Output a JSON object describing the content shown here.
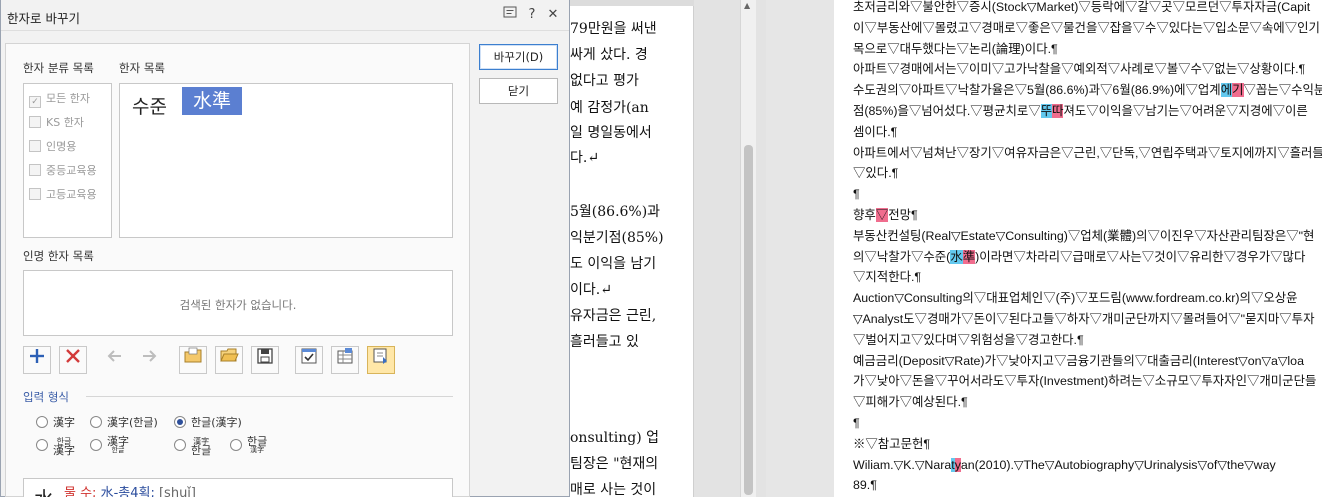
{
  "dialog": {
    "title": "한자로 바꾸기",
    "titlebar_icons": [
      "window-icon",
      "help-icon",
      "close-icon"
    ],
    "help_label": "?",
    "close_label": "✕",
    "category_label": "한자 분류 목록",
    "hanja_list_label": "한자 목록",
    "categories": [
      {
        "label": "모든 한자",
        "checked": true
      },
      {
        "label": "KS 한자",
        "checked": false
      },
      {
        "label": "인명용",
        "checked": false
      },
      {
        "label": "중등교육용",
        "checked": false
      },
      {
        "label": "고등교육용",
        "checked": false
      }
    ],
    "reading": "수준",
    "hanja_selected": "水準",
    "person_label": "인명 한자 목록",
    "person_empty": "검색된 한자가 없습니다.",
    "format_label": "입력 형식",
    "formats_row1": [
      "漢字",
      "漢字(한글)",
      "한글(漢字)"
    ],
    "format_stack": [
      {
        "top": "한글",
        "bottom": "漢字"
      },
      {
        "top": "漢字",
        "bottom": "한글"
      },
      {
        "top": "漢字",
        "bottom": "한글"
      },
      {
        "top": "한글",
        "bottom": "漢字"
      }
    ],
    "selected_format": "한글(漢字)",
    "info_char": "水",
    "info_meaning": "물 수;",
    "info_radical": "水-총4획;",
    "info_pinyin": "[shuǐ]",
    "replace_button": "바꾸기(D)",
    "close_button": "닫기"
  },
  "doc_left_lines": [
    "79만원을 써낸",
    "싸게 샀다. 경",
    "없다고 평가",
    "예 감정가(an",
    "일 명일동에서",
    "다.↵",
    "5월(86.6%)과",
    "익분기점(85%)",
    "도 이익을 남기",
    "이다.↵",
    "유자금은 근린,",
    "흘러들고 있",
    "onsulting) 업",
    "팀장은 \"현재의",
    "매로 사는 것이"
  ],
  "doc_right_lines": [
    [
      {
        "t": "초저금리와▽불안한▽증시(Stock▽Market)▽등락에▽갈▽곳▽모르던▽투자자금(Capit"
      }
    ],
    [
      {
        "t": "이▽부동산에▽몰렸고▽경매로▽좋은▽물건을▽잡을▽수▽있다는▽입소문▽속에▽인기"
      }
    ],
    [
      {
        "t": "목으로▽대두했다는▽논리(論理)이다.¶"
      }
    ],
    [
      {
        "t": "아파트▽경매에서는▽이미▽고가낙찰을▽예외적▽사례로▽볼▽수▽없는▽상황이다.¶"
      }
    ],
    [
      {
        "t": "수도권의▽아파트▽낙찰가율은▽5월(86.6%)과▽6월(86.9%)에▽업계"
      },
      {
        "t": "에",
        "c": "b"
      },
      {
        "t": "기",
        "c": "p"
      },
      {
        "t": "▽꼽는▽수익분"
      }
    ],
    [
      {
        "t": "점(85%)을▽넘어섰다.▽평균치로▽"
      },
      {
        "t": "뚜",
        "c": "b"
      },
      {
        "t": "따",
        "c": "p"
      },
      {
        "t": "져도▽이익을▽남기는▽어려운▽지경에▽이른"
      }
    ],
    [
      {
        "t": "셈이다.¶"
      }
    ],
    [
      {
        "t": "아파트에서▽넘쳐난▽장기▽여유자금은▽근린,▽단독,▽연립주택과▽토지에까지▽흘러들"
      }
    ],
    [
      {
        "t": "▽있다.¶"
      }
    ],
    [
      {
        "t": "¶"
      }
    ],
    [
      {
        "t": "향후"
      },
      {
        "t": "▽",
        "c": "p"
      },
      {
        "t": "전망¶"
      }
    ],
    [
      {
        "t": "부동산컨설팅(Real▽Estate▽Consulting)▽업체(業體)의▽이진우▽자산관리팀장은▽\"현"
      }
    ],
    [
      {
        "t": "의▽낙찰가▽수준("
      },
      {
        "t": "水",
        "c": "b"
      },
      {
        "t": "準",
        "c": "p"
      },
      {
        "t": ")이라면▽차라리▽급매로▽사는▽것이▽유리한▽경우가▽많다"
      }
    ],
    [
      {
        "t": "▽지적한다.¶"
      }
    ],
    [
      {
        "t": "Auction▽Consulting의▽대표업체인▽(주)▽포드림(www.fordream.co.kr)의▽오상윤"
      }
    ],
    [
      {
        "t": "▽Analyst도▽경매가▽돈이▽된다고들▽하자▽개미군단까지▽몰려들어▽\"묻지마▽투자"
      }
    ],
    [
      {
        "t": "▽벌어지고▽있다며▽위험성을▽경고한다.¶"
      }
    ],
    [
      {
        "t": "예금금리(Deposit▽Rate)가▽낮아지고▽금융기관들의▽대출금리(Interest▽on▽a▽loa"
      }
    ],
    [
      {
        "t": "가▽낮아▽돈을▽꾸어서라도▽투자(Investment)하려는▽소규모▽투자자인▽개미군단들"
      }
    ],
    [
      {
        "t": "▽피해가▽예상된다.¶"
      }
    ],
    [
      {
        "t": "¶"
      }
    ],
    [
      {
        "t": "※▽참고문헌¶"
      }
    ],
    [
      {
        "t": "Wiliam.▽K.▽Nara"
      },
      {
        "t": "t",
        "c": "b"
      },
      {
        "t": "y",
        "c": "p"
      },
      {
        "t": "an(2010).▽The▽Autobiography▽Urinalysis▽of▽the▽way"
      }
    ],
    [
      {
        "t": "89.¶"
      }
    ]
  ]
}
